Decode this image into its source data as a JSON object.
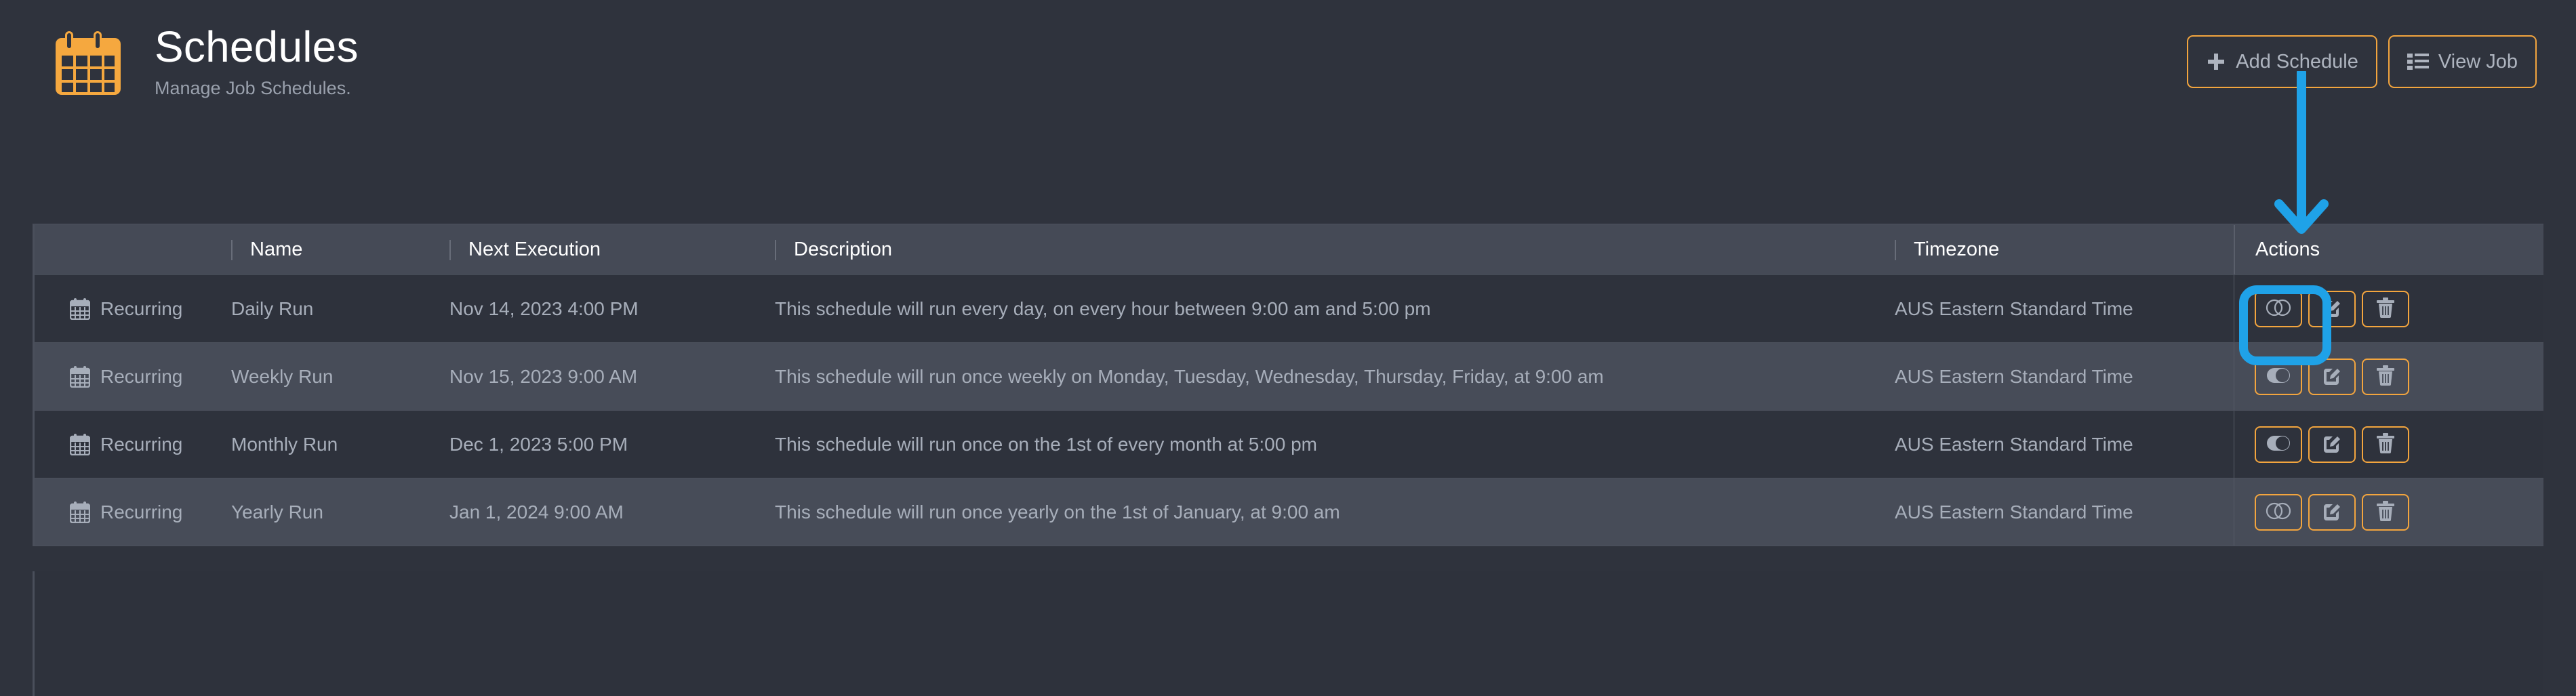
{
  "header": {
    "title": "Schedules",
    "subtitle": "Manage Job Schedules.",
    "logo_icon": "calendar-icon",
    "buttons": [
      {
        "label": "Add Schedule",
        "icon": "plus-icon",
        "name": "add-schedule-button"
      },
      {
        "label": "View Job",
        "icon": "list-icon",
        "name": "view-job-button"
      }
    ]
  },
  "table": {
    "columns": [
      {
        "key": "type",
        "label": ""
      },
      {
        "key": "name",
        "label": "Name"
      },
      {
        "key": "next",
        "label": "Next Execution"
      },
      {
        "key": "desc",
        "label": "Description"
      },
      {
        "key": "timezone",
        "label": "Timezone"
      },
      {
        "key": "actions",
        "label": "Actions"
      }
    ],
    "rows": [
      {
        "type": "Recurring",
        "type_icon": "calendar-icon",
        "name": "Daily Run",
        "next": "Nov 14, 2023 4:00 PM",
        "desc": "This schedule will run every day, on every hour between 9:00 am and 5:00 pm",
        "timezone": "AUS Eastern Standard Time",
        "toggle_state": "off",
        "actions": [
          "toggle-icon",
          "edit-icon",
          "delete-icon"
        ]
      },
      {
        "type": "Recurring",
        "type_icon": "calendar-icon",
        "name": "Weekly Run",
        "next": "Nov 15, 2023 9:00 AM",
        "desc": "This schedule will run once weekly on Monday, Tuesday, Wednesday, Thursday, Friday, at 9:00 am",
        "timezone": "AUS Eastern Standard Time",
        "toggle_state": "on",
        "actions": [
          "toggle-icon",
          "edit-icon",
          "delete-icon"
        ]
      },
      {
        "type": "Recurring",
        "type_icon": "calendar-icon",
        "name": "Monthly Run",
        "next": "Dec 1, 2023 5:00 PM",
        "desc": "This schedule will run once on the 1st of every month at 5:00 pm",
        "timezone": "AUS Eastern Standard Time",
        "toggle_state": "on",
        "actions": [
          "toggle-icon",
          "edit-icon",
          "delete-icon"
        ]
      },
      {
        "type": "Recurring",
        "type_icon": "calendar-icon",
        "name": "Yearly Run",
        "next": "Jan 1, 2024 9:00 AM",
        "desc": "This schedule will run once yearly on the 1st of January, at 9:00 am",
        "timezone": "AUS Eastern Standard Time",
        "toggle_state": "off",
        "actions": [
          "toggle-icon",
          "edit-icon",
          "delete-icon"
        ]
      }
    ]
  },
  "annotations": {
    "arrow": {
      "name": "highlight-arrow",
      "color": "#1fa2e8",
      "points_to": "toggle-icon of first row"
    },
    "box": {
      "name": "highlight-box",
      "color": "#1fa2e8",
      "surrounds": "toggle-icon of first row"
    }
  },
  "colors": {
    "accent": "#f3a53e",
    "annotation": "#1fa2e8",
    "background": "#2f333d",
    "row_alt": "#474c58",
    "text": "#a7aeba",
    "heading": "#ffffff"
  }
}
